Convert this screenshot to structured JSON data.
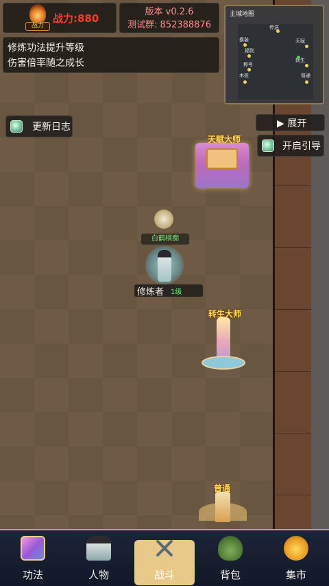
{
  "hud": {
    "power_label": "战力:880",
    "power_plate": "战力",
    "version": "版本 v0.2.6",
    "test_group": "测试群: 852388876"
  },
  "tips": {
    "line1": "修炼功法提升等级",
    "line2": "伤害倍率随之成长"
  },
  "minimap": {
    "title": "主城地图",
    "nodes": [
      "传送",
      "换装",
      "天赋",
      "福利",
      "转生",
      "称号",
      "木桩",
      "普通"
    ]
  },
  "buttons": {
    "update_log": "更新日志",
    "expand": "▶ 展开",
    "open_guide": "开启引导"
  },
  "buildings": {
    "talent": "天赋大师",
    "rebirth": "转生大师",
    "common": "普通"
  },
  "npc": {
    "name": "白鹤棋痴"
  },
  "player": {
    "title": "修炼者",
    "level": "1级"
  },
  "nav": {
    "items": [
      {
        "label": "功法",
        "icon": "technique-book-icon"
      },
      {
        "label": "人物",
        "icon": "character-icon"
      },
      {
        "label": "战斗",
        "icon": "crossed-swords-icon",
        "active": true
      },
      {
        "label": "背包",
        "icon": "bag-icon"
      },
      {
        "label": "集市",
        "icon": "market-coins-icon"
      }
    ]
  },
  "colors": {
    "power": "#ff3a2a",
    "version": "#ff8d8d",
    "building_title": "#ffd85a",
    "npc_name": "#7ff07a",
    "nav_active": "#e8c98a"
  }
}
